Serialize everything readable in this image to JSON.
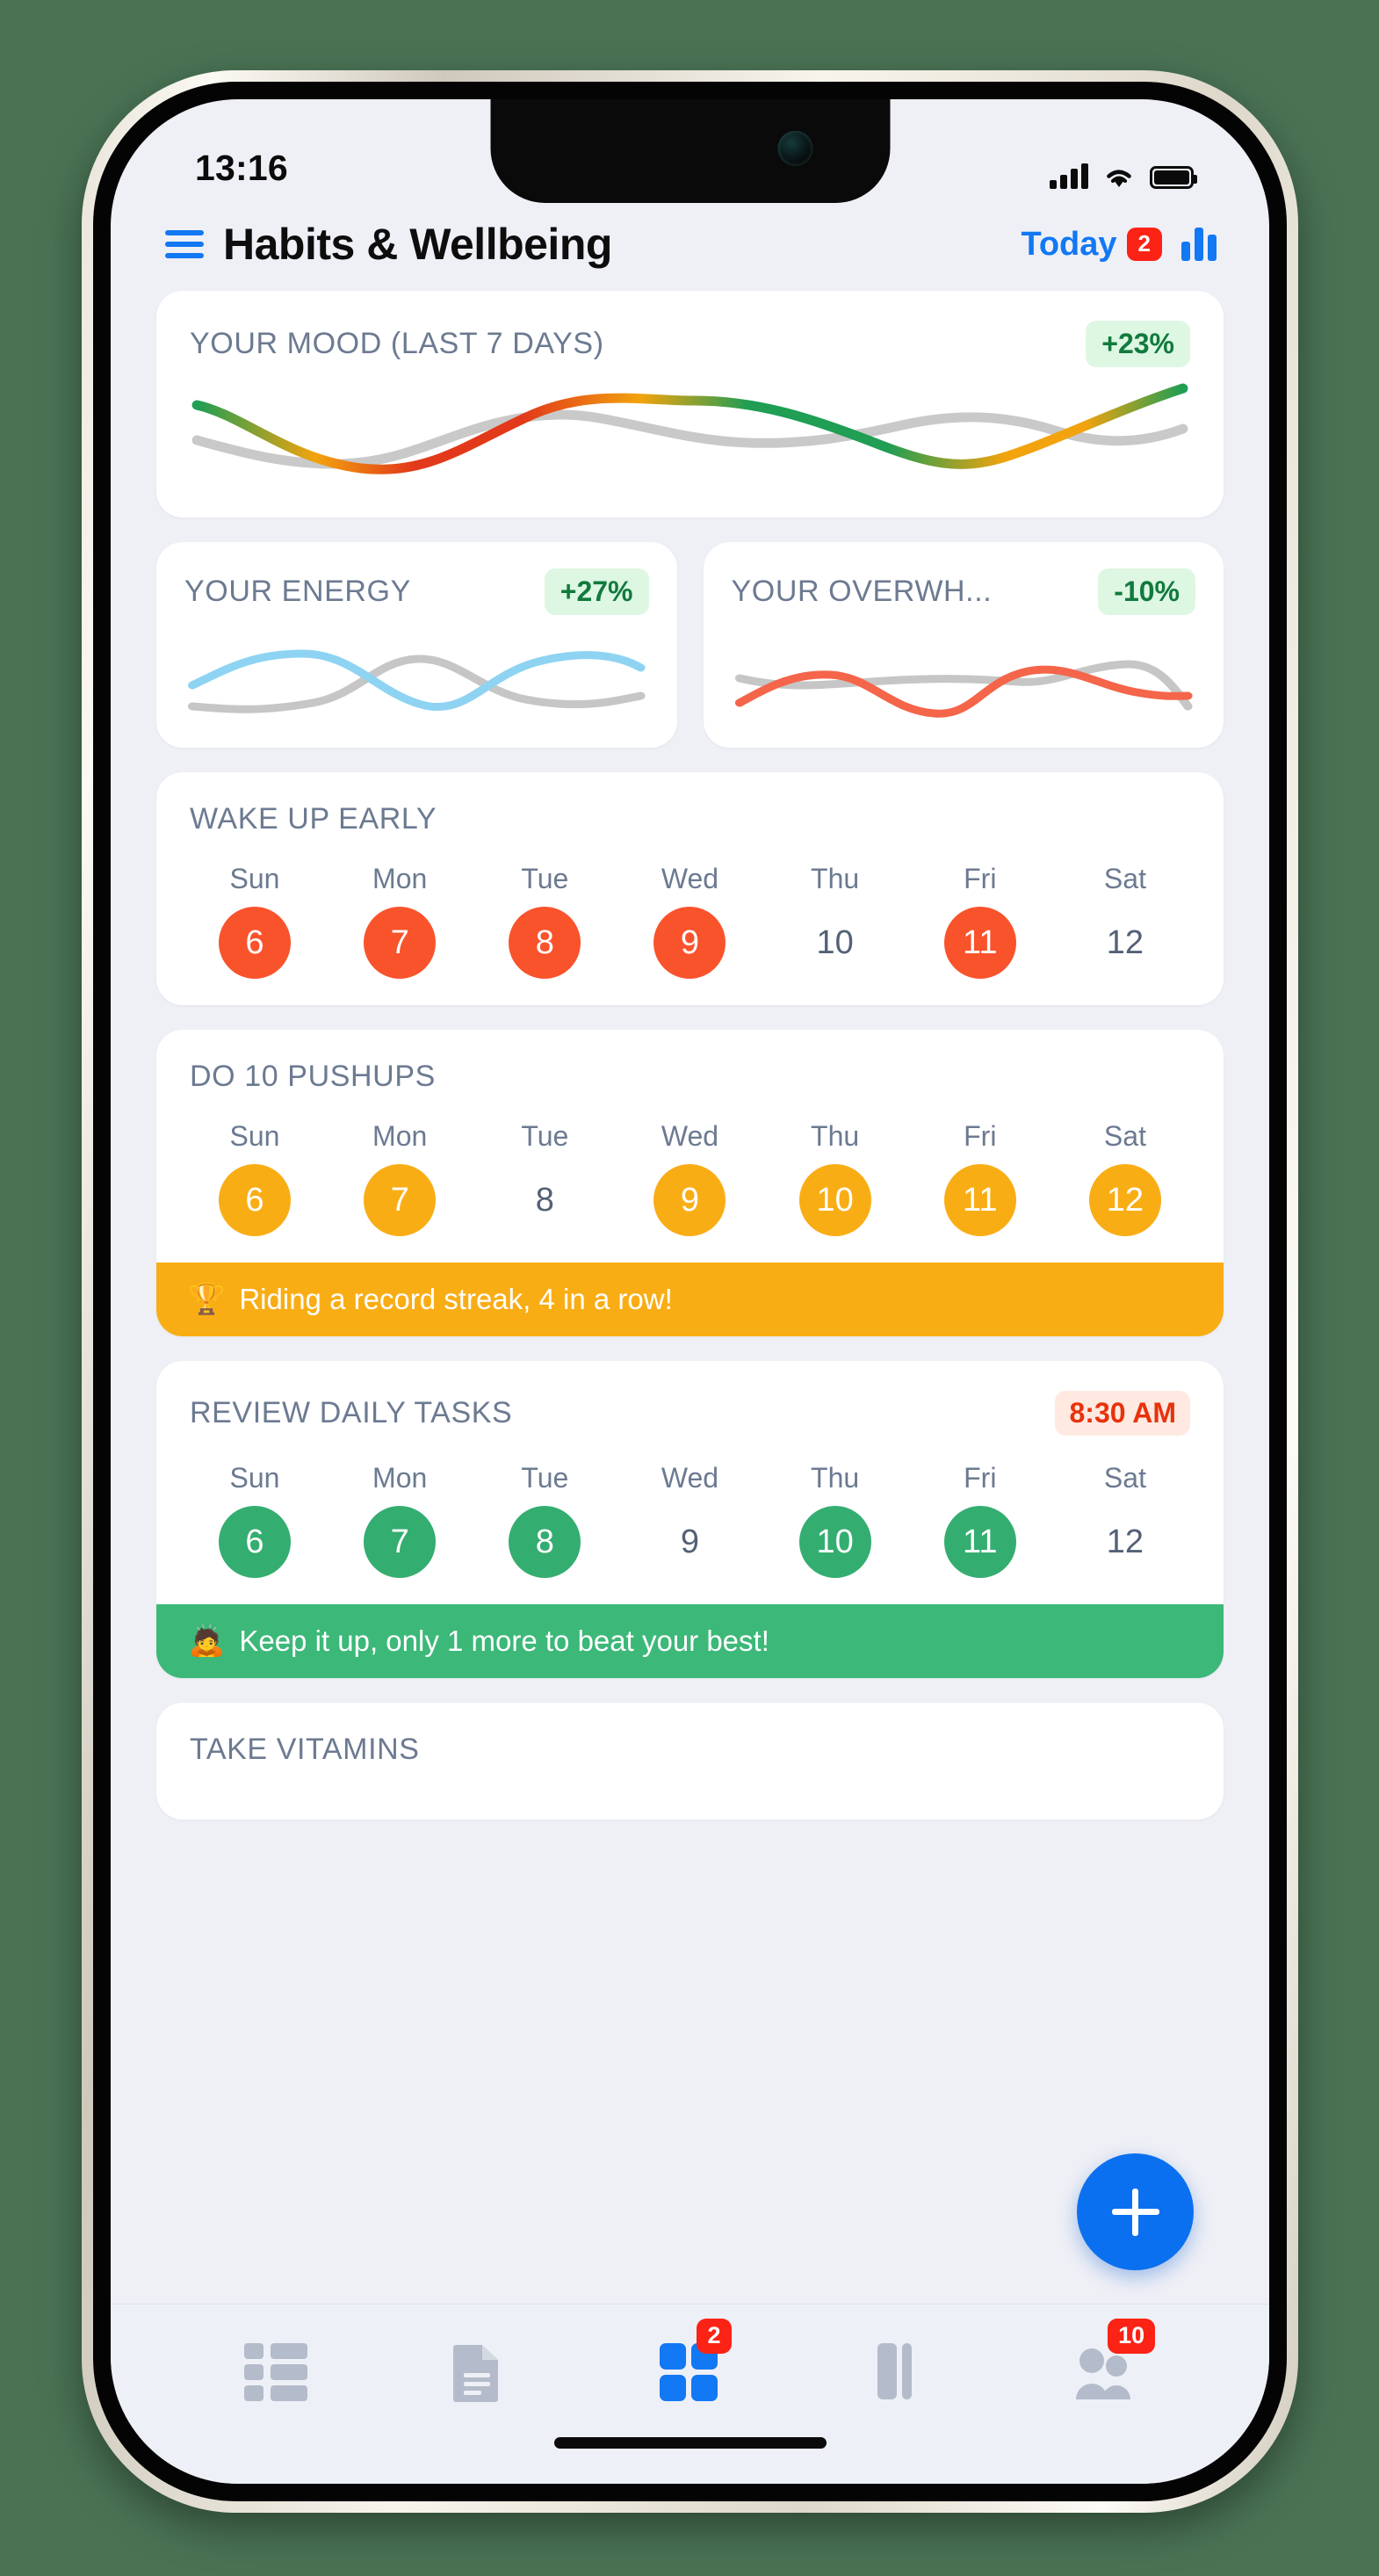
{
  "status_bar": {
    "time": "13:16",
    "icons": [
      "cellular-signal-icon",
      "wifi-icon",
      "battery-icon"
    ]
  },
  "header": {
    "menu_icon": "hamburger-menu-icon",
    "title": "Habits & Wellbeing",
    "today_label": "Today",
    "today_badge": "2",
    "stats_icon": "bar-chart-icon"
  },
  "mood_card": {
    "title": "YOUR MOOD (LAST 7 DAYS)",
    "delta": "+23%"
  },
  "mini_cards": [
    {
      "title": "YOUR ENERGY",
      "delta": "+27%",
      "line_color": "#8ed3f2"
    },
    {
      "title": "YOUR OVERWH...",
      "delta": "-10%",
      "line_color": "#f4654a"
    }
  ],
  "habits": [
    {
      "title": "WAKE UP EARLY",
      "time_badge": "",
      "color": "#f9532c",
      "days": [
        {
          "name": "Sun",
          "num": "6",
          "done": true
        },
        {
          "name": "Mon",
          "num": "7",
          "done": true
        },
        {
          "name": "Tue",
          "num": "8",
          "done": true
        },
        {
          "name": "Wed",
          "num": "9",
          "done": true
        },
        {
          "name": "Thu",
          "num": "10",
          "done": false
        },
        {
          "name": "Fri",
          "num": "11",
          "done": true
        },
        {
          "name": "Sat",
          "num": "12",
          "done": false
        }
      ],
      "banner": null
    },
    {
      "title": "DO 10 PUSHUPS",
      "time_badge": "",
      "color": "#f9ad15",
      "days": [
        {
          "name": "Sun",
          "num": "6",
          "done": true
        },
        {
          "name": "Mon",
          "num": "7",
          "done": true
        },
        {
          "name": "Tue",
          "num": "8",
          "done": false
        },
        {
          "name": "Wed",
          "num": "9",
          "done": true
        },
        {
          "name": "Thu",
          "num": "10",
          "done": true
        },
        {
          "name": "Fri",
          "num": "11",
          "done": true
        },
        {
          "name": "Sat",
          "num": "12",
          "done": true
        }
      ],
      "banner": {
        "emoji": "🏆",
        "text": "Riding a record streak, 4 in a row!",
        "bg": "#f9ad15"
      }
    },
    {
      "title": "REVIEW DAILY TASKS",
      "time_badge": "8:30 AM",
      "color": "#34ad71",
      "days": [
        {
          "name": "Sun",
          "num": "6",
          "done": true
        },
        {
          "name": "Mon",
          "num": "7",
          "done": true
        },
        {
          "name": "Tue",
          "num": "8",
          "done": true
        },
        {
          "name": "Wed",
          "num": "9",
          "done": false
        },
        {
          "name": "Thu",
          "num": "10",
          "done": true
        },
        {
          "name": "Fri",
          "num": "11",
          "done": true
        },
        {
          "name": "Sat",
          "num": "12",
          "done": false
        }
      ],
      "banner": {
        "emoji": "🙇",
        "text": "Keep it up, only 1 more to beat your best!",
        "bg": "#3cb878"
      }
    }
  ],
  "partial_card": {
    "title": "TAKE VITAMINS"
  },
  "fab": {
    "icon": "plus-icon",
    "color": "#0b70ef"
  },
  "tab_bar": {
    "items": [
      {
        "icon": "list-icon",
        "badge": "",
        "active": false
      },
      {
        "icon": "document-icon",
        "badge": "",
        "active": false
      },
      {
        "icon": "grid-icon",
        "badge": "2",
        "active": true
      },
      {
        "icon": "columns-icon",
        "badge": "",
        "active": false
      },
      {
        "icon": "people-icon",
        "badge": "10",
        "active": false
      }
    ]
  },
  "chart_data": [
    {
      "type": "line",
      "title": "YOUR MOOD (LAST 7 DAYS)",
      "xlabel": "",
      "ylabel": "",
      "series": [
        {
          "name": "mood",
          "values": [
            72,
            30,
            16,
            34,
            62,
            85,
            84,
            66,
            38,
            24,
            40,
            90
          ],
          "gradient": [
            "#1f9e54",
            "#f2a30e",
            "#e2391a",
            "#f2a30e",
            "#1f9e54"
          ]
        },
        {
          "name": "previous",
          "values": [
            48,
            40,
            36,
            52,
            70,
            60,
            42,
            40,
            52,
            60,
            44,
            30
          ],
          "color": "#c9c9c9"
        }
      ],
      "ylim": [
        0,
        100
      ],
      "grid": false,
      "legend": "none"
    },
    {
      "type": "line",
      "title": "YOUR ENERGY",
      "series": [
        {
          "name": "energy",
          "values": [
            42,
            72,
            82,
            70,
            40,
            14,
            22,
            58,
            78,
            80,
            70
          ],
          "color": "#8ed3f2"
        },
        {
          "name": "previous",
          "values": [
            22,
            20,
            24,
            40,
            66,
            76,
            58,
            26,
            20,
            26,
            34
          ],
          "color": "#c9c9c9"
        }
      ],
      "ylim": [
        0,
        100
      ],
      "grid": false,
      "legend": "none"
    },
    {
      "type": "line",
      "title": "YOUR OVERWH...",
      "series": [
        {
          "name": "overwhelm",
          "values": [
            18,
            48,
            52,
            40,
            20,
            10,
            30,
            70,
            78,
            62,
            44,
            36
          ],
          "color": "#f4654a"
        },
        {
          "name": "previous",
          "values": [
            50,
            42,
            40,
            46,
            50,
            50,
            48,
            56,
            66,
            72,
            60,
            24
          ],
          "color": "#c9c9c9"
        }
      ],
      "ylim": [
        0,
        100
      ],
      "grid": false,
      "legend": "none"
    }
  ]
}
